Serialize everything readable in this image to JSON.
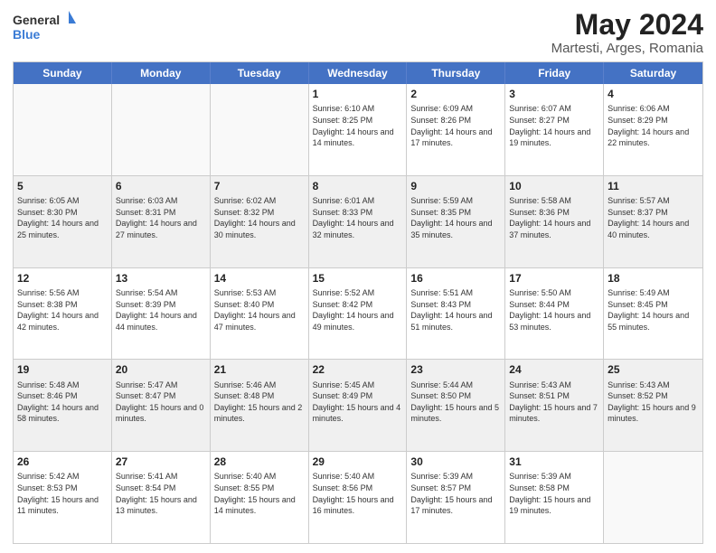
{
  "logo": {
    "text_general": "General",
    "text_blue": "Blue"
  },
  "header": {
    "month_title": "May 2024",
    "location": "Martesti, Arges, Romania"
  },
  "day_names": [
    "Sunday",
    "Monday",
    "Tuesday",
    "Wednesday",
    "Thursday",
    "Friday",
    "Saturday"
  ],
  "weeks": [
    [
      {
        "day": "",
        "empty": true
      },
      {
        "day": "",
        "empty": true
      },
      {
        "day": "",
        "empty": true
      },
      {
        "day": "1",
        "sunrise": "Sunrise: 6:10 AM",
        "sunset": "Sunset: 8:25 PM",
        "daylight": "Daylight: 14 hours and 14 minutes."
      },
      {
        "day": "2",
        "sunrise": "Sunrise: 6:09 AM",
        "sunset": "Sunset: 8:26 PM",
        "daylight": "Daylight: 14 hours and 17 minutes."
      },
      {
        "day": "3",
        "sunrise": "Sunrise: 6:07 AM",
        "sunset": "Sunset: 8:27 PM",
        "daylight": "Daylight: 14 hours and 19 minutes."
      },
      {
        "day": "4",
        "sunrise": "Sunrise: 6:06 AM",
        "sunset": "Sunset: 8:29 PM",
        "daylight": "Daylight: 14 hours and 22 minutes."
      }
    ],
    [
      {
        "day": "5",
        "sunrise": "Sunrise: 6:05 AM",
        "sunset": "Sunset: 8:30 PM",
        "daylight": "Daylight: 14 hours and 25 minutes."
      },
      {
        "day": "6",
        "sunrise": "Sunrise: 6:03 AM",
        "sunset": "Sunset: 8:31 PM",
        "daylight": "Daylight: 14 hours and 27 minutes."
      },
      {
        "day": "7",
        "sunrise": "Sunrise: 6:02 AM",
        "sunset": "Sunset: 8:32 PM",
        "daylight": "Daylight: 14 hours and 30 minutes."
      },
      {
        "day": "8",
        "sunrise": "Sunrise: 6:01 AM",
        "sunset": "Sunset: 8:33 PM",
        "daylight": "Daylight: 14 hours and 32 minutes."
      },
      {
        "day": "9",
        "sunrise": "Sunrise: 5:59 AM",
        "sunset": "Sunset: 8:35 PM",
        "daylight": "Daylight: 14 hours and 35 minutes."
      },
      {
        "day": "10",
        "sunrise": "Sunrise: 5:58 AM",
        "sunset": "Sunset: 8:36 PM",
        "daylight": "Daylight: 14 hours and 37 minutes."
      },
      {
        "day": "11",
        "sunrise": "Sunrise: 5:57 AM",
        "sunset": "Sunset: 8:37 PM",
        "daylight": "Daylight: 14 hours and 40 minutes."
      }
    ],
    [
      {
        "day": "12",
        "sunrise": "Sunrise: 5:56 AM",
        "sunset": "Sunset: 8:38 PM",
        "daylight": "Daylight: 14 hours and 42 minutes."
      },
      {
        "day": "13",
        "sunrise": "Sunrise: 5:54 AM",
        "sunset": "Sunset: 8:39 PM",
        "daylight": "Daylight: 14 hours and 44 minutes."
      },
      {
        "day": "14",
        "sunrise": "Sunrise: 5:53 AM",
        "sunset": "Sunset: 8:40 PM",
        "daylight": "Daylight: 14 hours and 47 minutes."
      },
      {
        "day": "15",
        "sunrise": "Sunrise: 5:52 AM",
        "sunset": "Sunset: 8:42 PM",
        "daylight": "Daylight: 14 hours and 49 minutes."
      },
      {
        "day": "16",
        "sunrise": "Sunrise: 5:51 AM",
        "sunset": "Sunset: 8:43 PM",
        "daylight": "Daylight: 14 hours and 51 minutes."
      },
      {
        "day": "17",
        "sunrise": "Sunrise: 5:50 AM",
        "sunset": "Sunset: 8:44 PM",
        "daylight": "Daylight: 14 hours and 53 minutes."
      },
      {
        "day": "18",
        "sunrise": "Sunrise: 5:49 AM",
        "sunset": "Sunset: 8:45 PM",
        "daylight": "Daylight: 14 hours and 55 minutes."
      }
    ],
    [
      {
        "day": "19",
        "sunrise": "Sunrise: 5:48 AM",
        "sunset": "Sunset: 8:46 PM",
        "daylight": "Daylight: 14 hours and 58 minutes."
      },
      {
        "day": "20",
        "sunrise": "Sunrise: 5:47 AM",
        "sunset": "Sunset: 8:47 PM",
        "daylight": "Daylight: 15 hours and 0 minutes."
      },
      {
        "day": "21",
        "sunrise": "Sunrise: 5:46 AM",
        "sunset": "Sunset: 8:48 PM",
        "daylight": "Daylight: 15 hours and 2 minutes."
      },
      {
        "day": "22",
        "sunrise": "Sunrise: 5:45 AM",
        "sunset": "Sunset: 8:49 PM",
        "daylight": "Daylight: 15 hours and 4 minutes."
      },
      {
        "day": "23",
        "sunrise": "Sunrise: 5:44 AM",
        "sunset": "Sunset: 8:50 PM",
        "daylight": "Daylight: 15 hours and 5 minutes."
      },
      {
        "day": "24",
        "sunrise": "Sunrise: 5:43 AM",
        "sunset": "Sunset: 8:51 PM",
        "daylight": "Daylight: 15 hours and 7 minutes."
      },
      {
        "day": "25",
        "sunrise": "Sunrise: 5:43 AM",
        "sunset": "Sunset: 8:52 PM",
        "daylight": "Daylight: 15 hours and 9 minutes."
      }
    ],
    [
      {
        "day": "26",
        "sunrise": "Sunrise: 5:42 AM",
        "sunset": "Sunset: 8:53 PM",
        "daylight": "Daylight: 15 hours and 11 minutes."
      },
      {
        "day": "27",
        "sunrise": "Sunrise: 5:41 AM",
        "sunset": "Sunset: 8:54 PM",
        "daylight": "Daylight: 15 hours and 13 minutes."
      },
      {
        "day": "28",
        "sunrise": "Sunrise: 5:40 AM",
        "sunset": "Sunset: 8:55 PM",
        "daylight": "Daylight: 15 hours and 14 minutes."
      },
      {
        "day": "29",
        "sunrise": "Sunrise: 5:40 AM",
        "sunset": "Sunset: 8:56 PM",
        "daylight": "Daylight: 15 hours and 16 minutes."
      },
      {
        "day": "30",
        "sunrise": "Sunrise: 5:39 AM",
        "sunset": "Sunset: 8:57 PM",
        "daylight": "Daylight: 15 hours and 17 minutes."
      },
      {
        "day": "31",
        "sunrise": "Sunrise: 5:39 AM",
        "sunset": "Sunset: 8:58 PM",
        "daylight": "Daylight: 15 hours and 19 minutes."
      },
      {
        "day": "",
        "empty": true
      }
    ]
  ]
}
